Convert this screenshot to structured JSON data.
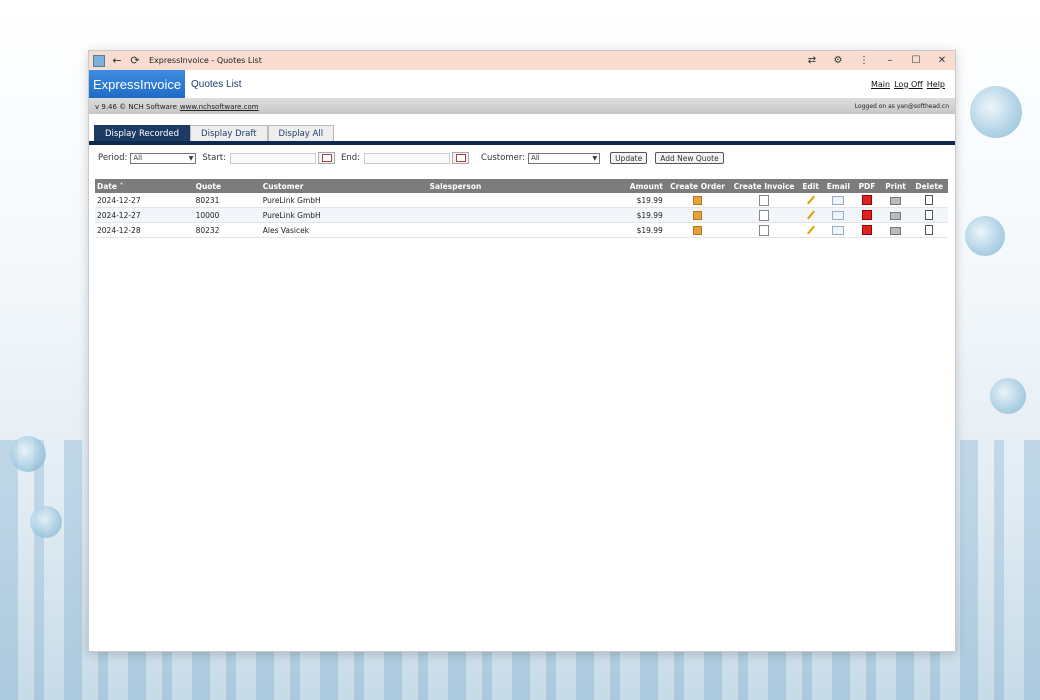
{
  "window": {
    "title": "ExpressInvoice - Quotes List"
  },
  "app": {
    "logo_text": "ExpressInvoice",
    "page_title": "Quotes List",
    "links": [
      "Main",
      "Log Off",
      "Help"
    ],
    "version_text": "v 9.46 © NCH Software",
    "website": "www.nchsoftware.com",
    "logged_in": "Logged on as yan@softhead.cn"
  },
  "tabs": [
    "Display Recorded",
    "Display Draft",
    "Display All"
  ],
  "active_tab": "Display Recorded",
  "filters": {
    "period_label": "Period:",
    "period_value": "All",
    "start_label": "Start:",
    "end_label": "End:",
    "customer_label": "Customer:",
    "customer_value": "All",
    "update_label": "Update",
    "add_label": "Add New Quote"
  },
  "table": {
    "headers": [
      "Date ˄",
      "Quote",
      "Customer",
      "Salesperson",
      "Amount",
      "Create Order",
      "Create Invoice",
      "Edit",
      "Email",
      "PDF",
      "Print",
      "Delete"
    ],
    "rows": [
      {
        "date": "2024-12-27",
        "quote": "80231",
        "customer": "PureLink GmbH",
        "salesperson": "",
        "amount": "$19.99"
      },
      {
        "date": "2024-12-27",
        "quote": "10000",
        "customer": "PureLink GmbH",
        "salesperson": "",
        "amount": "$19.99"
      },
      {
        "date": "2024-12-28",
        "quote": "80232",
        "customer": "Ales Vasicek",
        "salesperson": "",
        "amount": "$19.99"
      }
    ]
  },
  "colors": {
    "titlebar": "#f8dccf",
    "logo": "#2a7bd6",
    "tab_active": "#1d3a64",
    "table_header": "#7c7c7c"
  },
  "icons": [
    "back-icon",
    "refresh-icon",
    "translate-icon",
    "extension-icon",
    "more-icon",
    "minimize-icon",
    "maximize-icon",
    "close-icon",
    "calendar-icon",
    "order-icon",
    "invoice-icon",
    "edit-icon",
    "email-icon",
    "pdf-icon",
    "print-icon",
    "delete-icon"
  ]
}
